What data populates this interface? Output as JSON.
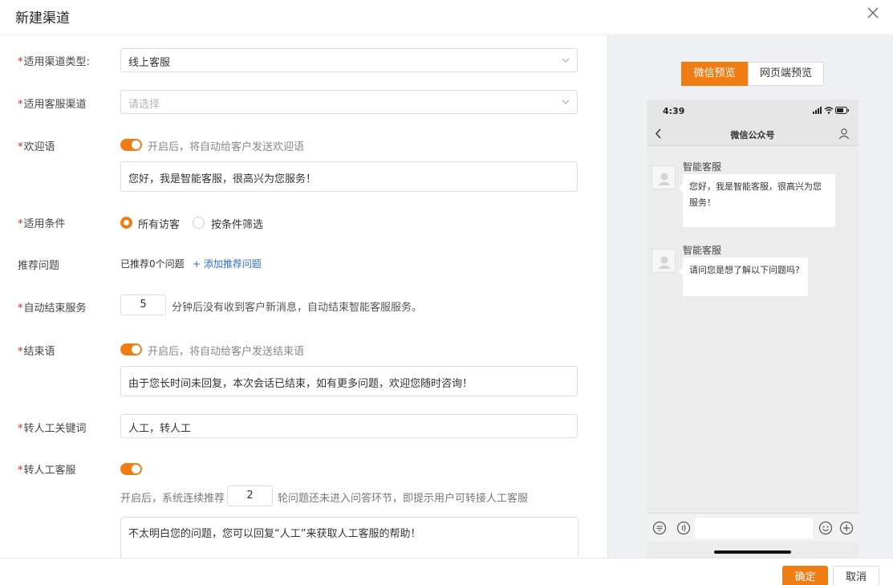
{
  "dialog": {
    "title": "新建渠道",
    "close_icon": "close-icon"
  },
  "form": {
    "required_mark": "*",
    "channel_type": {
      "label": "适用渠道类型:",
      "value": "线上客服"
    },
    "service_channel": {
      "label": "适用客服渠道",
      "placeholder": "请选择"
    },
    "welcome": {
      "label": "欢迎语",
      "toggle_on": true,
      "hint": "开启后，将自动给客户发送欢迎语",
      "value": "您好，我是智能客服，很高兴为您服务！"
    },
    "condition": {
      "label": "适用条件",
      "options": [
        "所有访客",
        "按条件筛选"
      ],
      "selected": "所有访客"
    },
    "recommend": {
      "label": "推荐问题",
      "status": "已推荐0个问题",
      "add_link": "+ 添加推荐问题"
    },
    "auto_end": {
      "label": "自动结束服务",
      "minutes": "5",
      "suffix": "分钟后没有收到客户新消息，自动结束智能客服服务。"
    },
    "closing": {
      "label": "结束语",
      "toggle_on": true,
      "hint": "开启后，将自动给客户发送结束语",
      "value": "由于您长时间未回复，本次会话已结束，如有更多问题，欢迎您随时咨询！"
    },
    "transfer_keywords": {
      "label": "转人工关键词",
      "value": "人工，转人工"
    },
    "transfer_agent": {
      "label": "转人工客服",
      "toggle_on": true,
      "prefix": "开启后，系统连续推荐",
      "rounds": "2",
      "suffix": "轮问题还未进入问答环节，即提示用户可转接人工客服",
      "message": "不太明白您的问题，您可以回复“人工”来获取人工客服的帮助！"
    }
  },
  "preview": {
    "tabs": [
      "微信预览",
      "网页端预览"
    ],
    "active_tab": "微信预览",
    "phone": {
      "time": "4:39",
      "nav_title": "微信公众号",
      "messages": [
        {
          "sender": "智能客服",
          "text_line1": "您好，我是智能客服，很高兴为您",
          "text_line2": "服务！"
        },
        {
          "sender": "智能客服",
          "text_line1": "请问您是想了解以下问题吗?"
        }
      ]
    }
  },
  "footer": {
    "confirm_label": "确定",
    "cancel_label": "取消"
  },
  "colors": {
    "accent": "#f07d14",
    "link": "#2b6fd6",
    "required": "#e02020"
  }
}
